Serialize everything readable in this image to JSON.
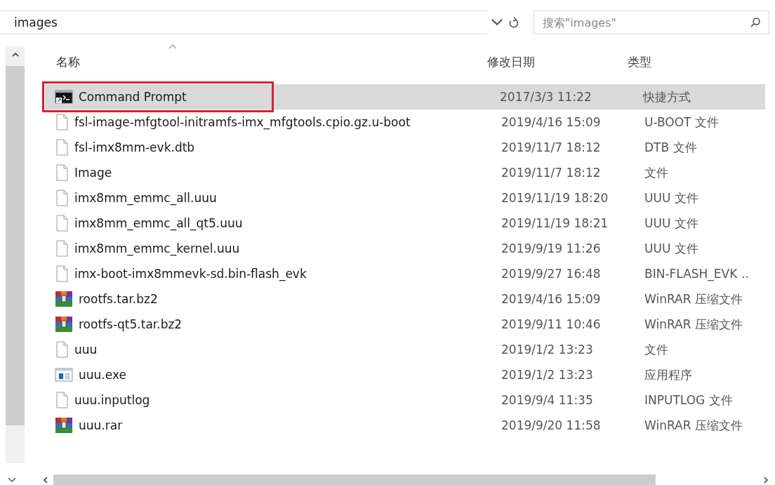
{
  "address_bar": {
    "path": "images"
  },
  "search": {
    "placeholder": "搜索\"images\""
  },
  "columns": [
    {
      "label": "名称",
      "sorted": true
    },
    {
      "label": "修改日期",
      "sorted": false
    },
    {
      "label": "类型",
      "sorted": false
    }
  ],
  "rows": [
    {
      "kind": "shortcut",
      "name": "Command Prompt",
      "modified": "2017/3/3 11:22",
      "type": "快捷方式",
      "selected": true,
      "annotated": true
    },
    {
      "kind": "file",
      "name": "fsl-image-mfgtool-initramfs-imx_mfgtools.cpio.gz.u-boot",
      "modified": "2019/4/16 15:09",
      "type": "U-BOOT 文件",
      "selected": false,
      "annotated": false
    },
    {
      "kind": "file",
      "name": "fsl-imx8mm-evk.dtb",
      "modified": "2019/11/7 18:12",
      "type": "DTB 文件",
      "selected": false,
      "annotated": false
    },
    {
      "kind": "file",
      "name": "Image",
      "modified": "2019/11/7 18:12",
      "type": "文件",
      "selected": false,
      "annotated": false
    },
    {
      "kind": "file",
      "name": "imx8mm_emmc_all.uuu",
      "modified": "2019/11/19 18:20",
      "type": "UUU 文件",
      "selected": false,
      "annotated": false
    },
    {
      "kind": "file",
      "name": "imx8mm_emmc_all_qt5.uuu",
      "modified": "2019/11/19 18:21",
      "type": "UUU 文件",
      "selected": false,
      "annotated": false
    },
    {
      "kind": "file",
      "name": "imx8mm_emmc_kernel.uuu",
      "modified": "2019/9/19 11:26",
      "type": "UUU 文件",
      "selected": false,
      "annotated": false
    },
    {
      "kind": "file",
      "name": "imx-boot-imx8mmevk-sd.bin-flash_evk",
      "modified": "2019/9/27 16:48",
      "type": "BIN-FLASH_EVK ..",
      "selected": false,
      "annotated": false
    },
    {
      "kind": "archive",
      "name": "rootfs.tar.bz2",
      "modified": "2019/4/16 15:09",
      "type": "WinRAR 压缩文件",
      "selected": false,
      "annotated": false
    },
    {
      "kind": "archive",
      "name": "rootfs-qt5.tar.bz2",
      "modified": "2019/9/11 10:46",
      "type": "WinRAR 压缩文件",
      "selected": false,
      "annotated": false
    },
    {
      "kind": "file",
      "name": "uuu",
      "modified": "2019/1/2 13:23",
      "type": "文件",
      "selected": false,
      "annotated": false
    },
    {
      "kind": "application",
      "name": "uuu.exe",
      "modified": "2019/1/2 13:23",
      "type": "应用程序",
      "selected": false,
      "annotated": false
    },
    {
      "kind": "file",
      "name": "uuu.inputlog",
      "modified": "2019/9/4 11:35",
      "type": "INPUTLOG 文件",
      "selected": false,
      "annotated": false
    },
    {
      "kind": "archive",
      "name": "uuu.rar",
      "modified": "2019/9/20 11:58",
      "type": "WinRAR 压缩文件",
      "selected": false,
      "annotated": false
    }
  ]
}
